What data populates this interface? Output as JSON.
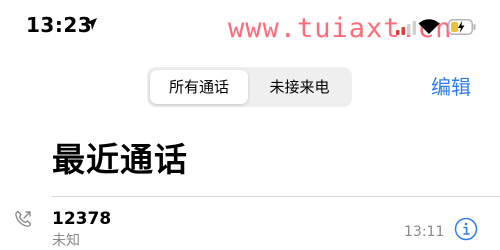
{
  "status_bar": {
    "time": "13:23",
    "watermark": "www.tuiaxt.cn",
    "icons": [
      "location-arrow-icon",
      "cellular-signal-icon",
      "wifi-icon",
      "battery-icon"
    ]
  },
  "segmented_control": {
    "options": [
      "所有通话",
      "未接来电"
    ],
    "selected": "所有通话"
  },
  "toolbar": {
    "edit_label": "编辑"
  },
  "page": {
    "title": "最近通话"
  },
  "calls": [
    {
      "number": "12378",
      "type": "未知",
      "time": "13:11"
    }
  ],
  "colors": {
    "accent": "#2f7ef0",
    "secondary_text": "#8a8a8e",
    "watermark": "#ff6b7a",
    "segment_background": "#efeff0",
    "signal_active": "#e03a3a",
    "battery_charge": "#e8c23b"
  }
}
